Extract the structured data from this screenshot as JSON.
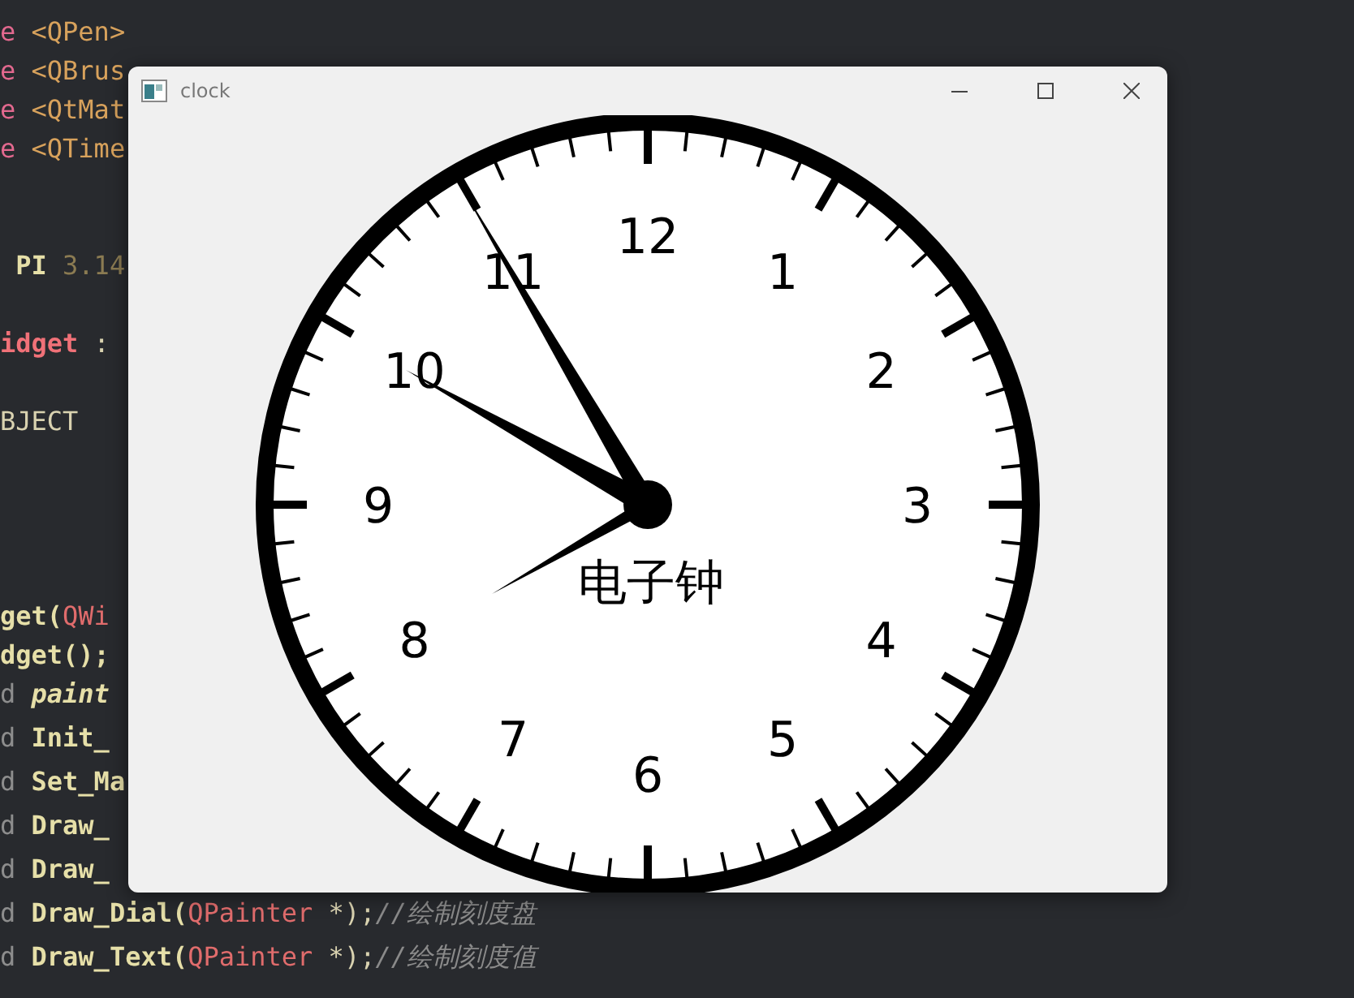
{
  "editor": {
    "lines": [
      [
        {
          "text": "e",
          "kind": "keyword"
        },
        {
          "text": " <QPen>",
          "kind": "include"
        }
      ],
      [
        {
          "text": "e",
          "kind": "keyword"
        },
        {
          "text": " <QBrus",
          "kind": "include"
        }
      ],
      [
        {
          "text": "e",
          "kind": "keyword"
        },
        {
          "text": " <QtMat",
          "kind": "include"
        }
      ],
      [
        {
          "text": "e",
          "kind": "keyword"
        },
        {
          "text": " <QTime",
          "kind": "include"
        }
      ],
      [
        {
          "text": " PI",
          "kind": "name"
        },
        {
          "text": " 3.14",
          "kind": "number"
        }
      ],
      [
        {
          "text": "idget",
          "kind": "class"
        },
        {
          "text": " :",
          "kind": "plain"
        }
      ],
      [
        {
          "text": "BJECT",
          "kind": "plain"
        }
      ],
      [
        {
          "text": "get(",
          "kind": "name"
        },
        {
          "text": "QWi",
          "kind": "type"
        }
      ],
      [
        {
          "text": "dget();",
          "kind": "name"
        }
      ],
      [
        {
          "text": "d",
          "kind": "dim"
        },
        {
          "text": " paint",
          "kind": "italic-name"
        }
      ],
      [
        {
          "text": "d",
          "kind": "dim"
        },
        {
          "text": " Init_",
          "kind": "name"
        }
      ],
      [
        {
          "text": "d",
          "kind": "dim"
        },
        {
          "text": " Set_Ma",
          "kind": "name"
        }
      ],
      [
        {
          "text": "d",
          "kind": "dim"
        },
        {
          "text": " Draw_",
          "kind": "name"
        }
      ],
      [
        {
          "text": "d",
          "kind": "dim"
        },
        {
          "text": " Draw_",
          "kind": "name"
        }
      ],
      [
        {
          "text": "d",
          "kind": "dim"
        },
        {
          "text": " Draw_Dial(",
          "kind": "name"
        },
        {
          "text": "QPainter",
          "kind": "type"
        },
        {
          "text": " *);",
          "kind": "plain"
        },
        {
          "text": "//绘制刻度盘",
          "kind": "comment"
        }
      ],
      [
        {
          "text": "d",
          "kind": "dim"
        },
        {
          "text": " Draw_Text(",
          "kind": "name"
        },
        {
          "text": "QPainter",
          "kind": "type"
        },
        {
          "text": " *);",
          "kind": "plain"
        },
        {
          "text": "//绘制刻度值",
          "kind": "comment"
        }
      ]
    ]
  },
  "window": {
    "title": "clock"
  },
  "clock": {
    "numbers": [
      "12",
      "1",
      "2",
      "3",
      "4",
      "5",
      "6",
      "7",
      "8",
      "9",
      "10",
      "11"
    ],
    "caption": "电子钟"
  }
}
